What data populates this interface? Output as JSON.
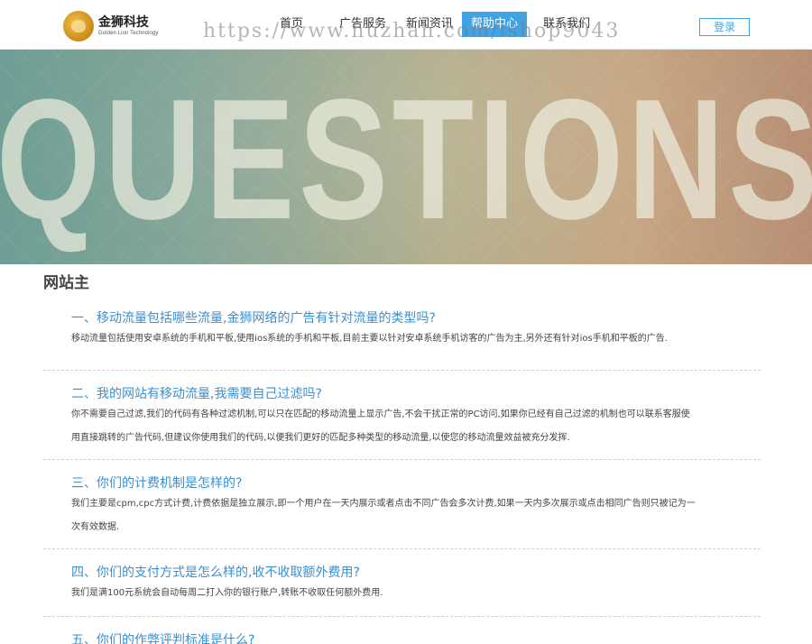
{
  "header": {
    "logo_cn": "金狮科技",
    "logo_en": "Golden Lion Technology",
    "nav": [
      {
        "label": "首页"
      },
      {
        "label": "广告服务"
      },
      {
        "label": "新闻资讯"
      },
      {
        "label": "帮助中心",
        "active": true
      },
      {
        "label": "联系我们"
      }
    ],
    "login_label": "登录",
    "watermark": "https://www.huzhan.com/ishop9043"
  },
  "banner": {
    "word": "QUESTIONS"
  },
  "main": {
    "section_title": "网站主",
    "faqs": [
      {
        "question": "一、移动流量包括哪些流量,金狮网络的广告有针对流量的类型吗?",
        "answer": [
          "移动流量包括使用安卓系统的手机和平板,使用ios系统的手机和平板,目前主要以针对安卓系统手机访客的广告为主,另外还有针对ios手机和平板的广告."
        ]
      },
      {
        "question": "二、我的网站有移动流量,我需要自己过滤吗?",
        "answer": [
          "你不需要自己过滤,我们的代码有各种过滤机制,可以只在匹配的移动流量上显示广告,不会干扰正常的PC访问,如果你已经有自己过滤的机制也可以联系客服使",
          "用直接跳转的广告代码,但建议你使用我们的代码,以便我们更好的匹配多种类型的移动流量,以使您的移动流量效益被充分发挥."
        ]
      },
      {
        "question": "三、你们的计费机制是怎样的?",
        "answer": [
          "我们主要是cpm,cpc方式计费,计费依据是独立展示,即一个用户在一天内展示或者点击不同广告会多次计费,如果一天内多次展示或点击相同广告则只被记为一",
          "次有效数据."
        ]
      },
      {
        "question": "四、你们的支付方式是怎么样的,收不收取额外费用?",
        "answer": [
          "我们是满100元系统会自动每周二打入你的银行账户,转账不收取任何额外费用."
        ]
      },
      {
        "question": "五、你们的作弊评判标准是什么?",
        "answer": []
      }
    ]
  },
  "colors": {
    "accent": "#3fa3e4",
    "question": "#3b8fd0"
  }
}
